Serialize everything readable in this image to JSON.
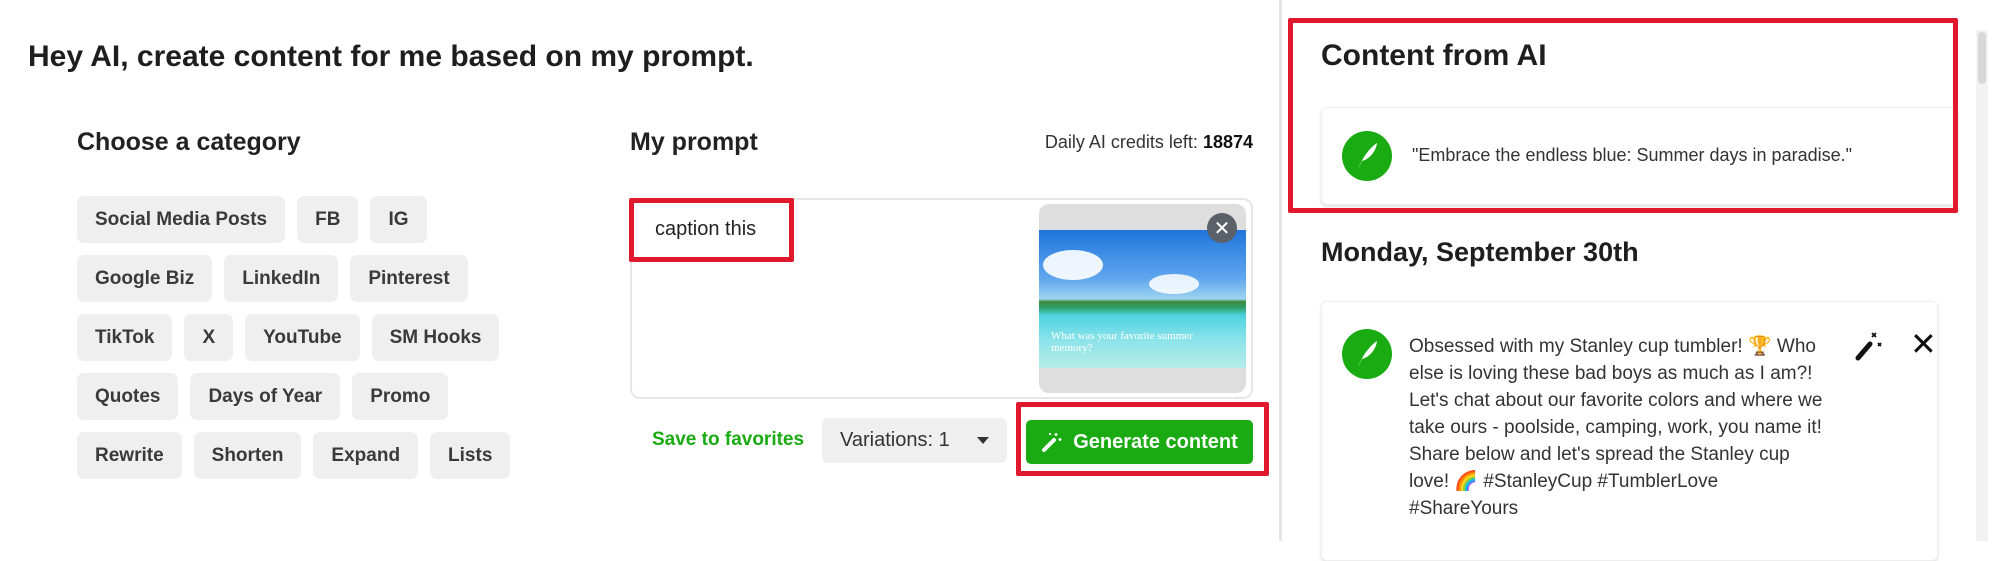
{
  "header": {
    "title": "Hey AI, create content for me based on my prompt."
  },
  "category": {
    "title": "Choose a category",
    "rows": [
      [
        "Social Media Posts",
        "FB",
        "IG"
      ],
      [
        "Google Biz",
        "LinkedIn",
        "Pinterest"
      ],
      [
        "TikTok",
        "X",
        "YouTube",
        "SM Hooks"
      ],
      [
        "Quotes",
        "Days of Year",
        "Promo"
      ],
      [
        "Rewrite",
        "Shorten",
        "Expand",
        "Lists"
      ]
    ]
  },
  "prompt": {
    "title": "My prompt",
    "credits_label": "Daily AI credits left:",
    "credits_value": "18874",
    "text": "caption this",
    "image_caption": "What was your favorite summer memory?",
    "remove_icon": "close-icon"
  },
  "actions": {
    "save": "Save to favorites",
    "variations": "Variations: 1",
    "generate": "Generate content",
    "generate_icon": "magic-wand-icon"
  },
  "results": {
    "title": "Content from AI",
    "latest": "\"Embrace the endless blue: Summer days in paradise.\"",
    "day_heading": "Monday, September 30th",
    "post": "Obsessed with my Stanley cup tumbler! 🏆 Who else is loving these bad boys as much as I am?! Let's chat about our favorite colors and where we take ours - poolside, camping, work, you name it! Share below and let's spread the Stanley cup love! 🌈 #StanleyCup #TumblerLove #ShareYours"
  },
  "colors": {
    "accent": "#1aab12",
    "highlight": "#e0192f",
    "chip_bg": "#efefef"
  }
}
